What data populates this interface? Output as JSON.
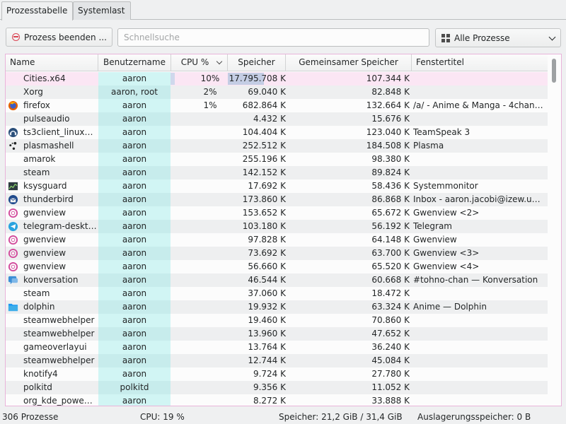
{
  "tabs": [
    {
      "label": "Prozesstabelle"
    },
    {
      "label": "Systemlast"
    }
  ],
  "toolbar": {
    "end_process_label": "Prozess beenden ...",
    "search_placeholder": "Schnellsuche",
    "search_value": "",
    "filter_selected": "Alle Prozesse"
  },
  "columns": [
    {
      "label": "Name"
    },
    {
      "label": "Benutzername"
    },
    {
      "label": "CPU %"
    },
    {
      "label": "Speicher"
    },
    {
      "label": "Gemeinsamer Speicher"
    },
    {
      "label": "Fenstertitel"
    }
  ],
  "rows": [
    {
      "icon": "none",
      "name": "Cities.x64",
      "user": "aaron",
      "cpu": "10%",
      "mem": "17.795.708 K",
      "shared": "107.344 K",
      "title": "",
      "selected": true
    },
    {
      "icon": "none",
      "name": "Xorg",
      "user": "aaron, root",
      "cpu": "2%",
      "mem": "69.040 K",
      "shared": "82.848 K",
      "title": ""
    },
    {
      "icon": "firefox-icon",
      "name": "firefox",
      "user": "aaron",
      "cpu": "1%",
      "mem": "682.864 K",
      "shared": "132.664 K",
      "title": "/a/ - Anime & Manga - 4chan …"
    },
    {
      "icon": "none",
      "name": "pulseaudio",
      "user": "aaron",
      "cpu": "",
      "mem": "4.432 K",
      "shared": "15.676 K",
      "title": ""
    },
    {
      "icon": "teamspeak-icon",
      "name": "ts3client_linux…",
      "user": "aaron",
      "cpu": "",
      "mem": "104.404 K",
      "shared": "123.040 K",
      "title": "TeamSpeak 3"
    },
    {
      "icon": "plasma-icon",
      "name": "plasmashell",
      "user": "aaron",
      "cpu": "",
      "mem": "252.512 K",
      "shared": "184.508 K",
      "title": "Plasma"
    },
    {
      "icon": "none",
      "name": "amarok",
      "user": "aaron",
      "cpu": "",
      "mem": "255.196 K",
      "shared": "98.380 K",
      "title": ""
    },
    {
      "icon": "none",
      "name": "steam",
      "user": "aaron",
      "cpu": "",
      "mem": "142.152 K",
      "shared": "89.824 K",
      "title": ""
    },
    {
      "icon": "ksysguard-icon",
      "name": "ksysguard",
      "user": "aaron",
      "cpu": "",
      "mem": "17.692 K",
      "shared": "58.436 K",
      "title": "Systemmonitor"
    },
    {
      "icon": "thunderbird-icon",
      "name": "thunderbird",
      "user": "aaron",
      "cpu": "",
      "mem": "173.860 K",
      "shared": "86.868 K",
      "title": "Inbox - aaron.jacobi@izew.uni…"
    },
    {
      "icon": "gwenview-icon",
      "name": "gwenview",
      "user": "aaron",
      "cpu": "",
      "mem": "153.652 K",
      "shared": "65.672 K",
      "title": "Gwenview <2>"
    },
    {
      "icon": "telegram-icon",
      "name": "telegram-desktop",
      "user": "aaron",
      "cpu": "",
      "mem": "103.180 K",
      "shared": "56.192 K",
      "title": "Telegram"
    },
    {
      "icon": "gwenview-icon",
      "name": "gwenview",
      "user": "aaron",
      "cpu": "",
      "mem": "97.828 K",
      "shared": "64.148 K",
      "title": "Gwenview"
    },
    {
      "icon": "gwenview-icon",
      "name": "gwenview",
      "user": "aaron",
      "cpu": "",
      "mem": "73.692 K",
      "shared": "63.700 K",
      "title": "Gwenview <3>"
    },
    {
      "icon": "gwenview-icon",
      "name": "gwenview",
      "user": "aaron",
      "cpu": "",
      "mem": "56.660 K",
      "shared": "65.520 K",
      "title": "Gwenview <4>"
    },
    {
      "icon": "konversation-icon",
      "name": "konversation",
      "user": "aaron",
      "cpu": "",
      "mem": "46.544 K",
      "shared": "60.668 K",
      "title": "#tohno-chan — Konversation"
    },
    {
      "icon": "none",
      "name": "steam",
      "user": "aaron",
      "cpu": "",
      "mem": "37.060 K",
      "shared": "18.472 K",
      "title": ""
    },
    {
      "icon": "dolphin-icon",
      "name": "dolphin",
      "user": "aaron",
      "cpu": "",
      "mem": "19.932 K",
      "shared": "63.324 K",
      "title": "Anime — Dolphin"
    },
    {
      "icon": "none",
      "name": "steamwebhelper",
      "user": "aaron",
      "cpu": "",
      "mem": "19.460 K",
      "shared": "70.860 K",
      "title": ""
    },
    {
      "icon": "none",
      "name": "steamwebhelper",
      "user": "aaron",
      "cpu": "",
      "mem": "13.960 K",
      "shared": "47.652 K",
      "title": ""
    },
    {
      "icon": "none",
      "name": "gameoverlayui",
      "user": "aaron",
      "cpu": "",
      "mem": "13.764 K",
      "shared": "36.240 K",
      "title": ""
    },
    {
      "icon": "none",
      "name": "steamwebhelper",
      "user": "aaron",
      "cpu": "",
      "mem": "12.744 K",
      "shared": "45.084 K",
      "title": ""
    },
    {
      "icon": "none",
      "name": "knotify4",
      "user": "aaron",
      "cpu": "",
      "mem": "9.724 K",
      "shared": "27.780 K",
      "title": ""
    },
    {
      "icon": "none",
      "name": "polkitd",
      "user": "polkitd",
      "cpu": "",
      "mem": "9.356 K",
      "shared": "11.052 K",
      "title": ""
    },
    {
      "icon": "none",
      "name": "org_kde_powe…",
      "user": "aaron",
      "cpu": "",
      "mem": "8.272 K",
      "shared": "33.888 K",
      "title": ""
    }
  ],
  "status": {
    "processes": "306 Prozesse",
    "cpu": "CPU: 19 %",
    "memory": "Speicher: 21,2 GiB / 31,4 GiB",
    "swap": "Auslagerungsspeicher: 0 B"
  }
}
